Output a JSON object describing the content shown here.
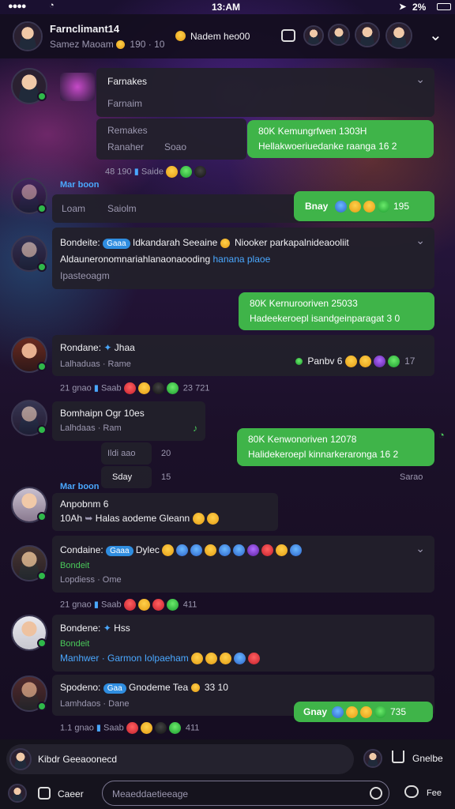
{
  "status": {
    "time": "13:AM",
    "battery": "2%"
  },
  "header": {
    "title": "Farnclimant14",
    "subtitle": "Samez Maoam",
    "subtitle_count": "190 · 10",
    "group": "Nadem heo00"
  },
  "messages": {
    "m1": {
      "name": "Farnakes",
      "line2": "Farnaim",
      "line3": "Remakes",
      "line4": "Ranaher",
      "meta": "Soao",
      "foot": "48 190",
      "foot2": "Saide"
    },
    "out1": {
      "line1": "80K Kemungrfwen 1303H",
      "line2": "Hellakwoeriuedanke raanga 16 2"
    },
    "sys1": "Mar boon",
    "m2": {
      "prefix": "Loam",
      "text": "Saiolm"
    },
    "out2": {
      "label": "Bnay",
      "count": "195"
    },
    "m3": {
      "name": "Bondeite:",
      "tag": "Gaaa",
      "text": "Idkandarah Seeaine",
      "text2": "Niooker parkapalnideaooliit",
      "line2": "Aldauneronomnariahlanaonaooding",
      "line2b": "hanana plaoe",
      "line3": "Ipasteoagm"
    },
    "out3": {
      "line1": "80K Kernurooriven 25033",
      "line2": "Hadeekeroepl isandgeinparagat 3 0"
    },
    "m4": {
      "name": "Rondane:",
      "text": "Jhaa",
      "right": "Panbv 6",
      "count": "17",
      "line2": "Lalhaduas · Rame",
      "foot": "21 gnao",
      "foot2": "Saab",
      "foot3": "23 721"
    },
    "m5": {
      "name": "Bomhaipn Ogr 10es",
      "line2": "Lalhdaas · Ram"
    },
    "out4": {
      "line1": "80K Kenwonoriven 12078",
      "line2": "Halidekeroepl kinnarkeraronga 16 2"
    },
    "sys2": {
      "l1": "Ildi aao",
      "c1": "20",
      "l2": "Sday",
      "c2": "15",
      "right": "Sarao"
    },
    "sys3": "Mar boon",
    "m6": {
      "name": "Anpobnm 6",
      "l2a": "10Ah",
      "l2b": "Halas aodeme Gleann"
    },
    "m7": {
      "name": "Condaine:",
      "tag": "Gaaa",
      "text": "Dylec",
      "line2": "Bondeit",
      "line3": "Lopdiess · Ome",
      "foot": "21 gnao",
      "foot2": "Saab",
      "foot3": "411"
    },
    "m8": {
      "name": "Bondene:",
      "text": "Hss",
      "line2": "Bondeit",
      "line3a": "Manhwer · Garmon",
      "line3b": "Iolpaeham"
    },
    "m9": {
      "name": "Spodeno:",
      "tag": "Gaa",
      "text": "Gnodeme Tea",
      "count": "33 10",
      "line2": "Lamhdaos · Dane",
      "foot": "1.1 gnao",
      "foot2": "Saab",
      "foot3": "411"
    },
    "out5": {
      "label": "Gnay",
      "count": "735"
    }
  },
  "composer": {
    "reply_name": "Kibdr",
    "reply_text": "Geeaoonecd",
    "share": "Gnelbe",
    "left_label": "Caeer",
    "placeholder": "Meaeddaetieeage",
    "right_label": "Fee"
  },
  "icons": [
    "back-icon",
    "camera-icon",
    "chevron-down-icon",
    "clock-icon",
    "share-icon",
    "camera-icon"
  ],
  "colors": {
    "accent_green": "#3fb449",
    "online": "#2fb84a",
    "link": "#4aa8ff"
  }
}
